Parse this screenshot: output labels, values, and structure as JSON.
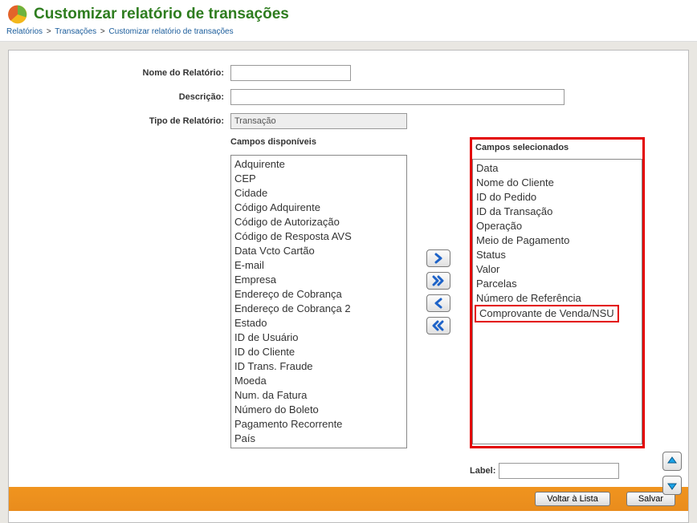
{
  "header": {
    "title": "Customizar relatório de transações",
    "breadcrumb": [
      "Relatórios",
      "Transações",
      "Customizar relatório de transações"
    ]
  },
  "form": {
    "name_label": "Nome do Relatório:",
    "name_value": "",
    "desc_label": "Descrição:",
    "desc_value": "",
    "type_label": "Tipo de Relatório:",
    "type_value": "Transação",
    "available_label": "Campos disponíveis",
    "selected_label": "Campos selecionados",
    "label_field_label": "Label:",
    "label_field_value": ""
  },
  "available": [
    "Adquirente",
    "CEP",
    "Cidade",
    "Código Adquirente",
    "Código de Autorização",
    "Código de Resposta AVS",
    "Data Vcto Cartão",
    "E-mail",
    "Empresa",
    "Endereço de Cobrança",
    "Endereço de Cobrança 2",
    "Estado",
    "ID de Usuário",
    "ID do Cliente",
    "ID Trans. Fraude",
    "Moeda",
    "Num. da Fatura",
    "Número do Boleto",
    "Pagamento Recorrente",
    "País"
  ],
  "selected": [
    "Data",
    "Nome do Cliente",
    "ID do Pedido",
    "ID da Transação",
    "Operação",
    "Meio de Pagamento",
    "Status",
    "Valor",
    "Parcelas",
    "Número de Referência",
    "Comprovante de Venda/NSU"
  ],
  "selected_highlight_index": 10,
  "buttons": {
    "add": "›",
    "add_all": "»",
    "remove": "‹",
    "remove_all": "«",
    "up": "▲",
    "down": "▼"
  },
  "footer": {
    "back": "Voltar à Lista",
    "save": "Salvar"
  },
  "colors": {
    "accent_green": "#2e7d1f",
    "highlight_red": "#e30000",
    "footer_orange": "#e98c1d"
  }
}
